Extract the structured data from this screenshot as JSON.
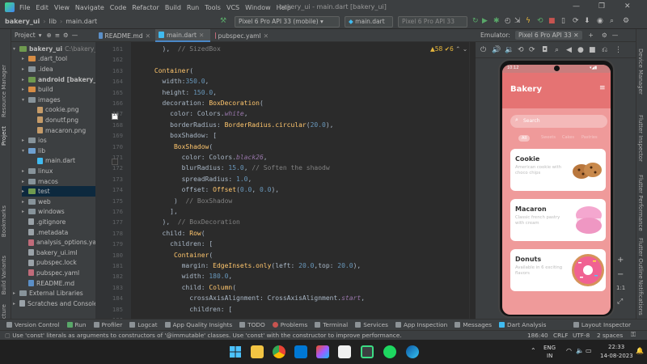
{
  "menu": {
    "items": [
      "File",
      "Edit",
      "View",
      "Navigate",
      "Code",
      "Refactor",
      "Build",
      "Run",
      "Tools",
      "VCS",
      "Window",
      "Help"
    ],
    "window_title": "bakery_ui - main.dart [bakery_ui]"
  },
  "nav": {
    "crumbs": [
      "bakery_ui",
      "lib",
      "main.dart"
    ],
    "device_combo": "Pixel 6 Pro API 33 (mobile)",
    "run_config": "main.dart",
    "avd_combo": "Pixel 6 Pro API 33"
  },
  "left_stripe": {
    "tabs": [
      "Resource Manager",
      "Project",
      "Bookmarks",
      "Build Variants",
      "Structure"
    ]
  },
  "project": {
    "header": "Project",
    "rows": [
      {
        "label": "bakery_ui",
        "suffix": "C:\\bakery_u",
        "type": "folder",
        "color": "gr",
        "indent": 0,
        "arrow": "▾",
        "bold": true
      },
      {
        "label": ".dart_tool",
        "type": "folder",
        "color": "or",
        "indent": 1,
        "arrow": "▸"
      },
      {
        "label": ".idea",
        "type": "folder",
        "color": "",
        "indent": 1,
        "arrow": "▸"
      },
      {
        "label": "android [bakery_ui",
        "type": "folder",
        "color": "gr",
        "indent": 1,
        "arrow": "▸",
        "bold": true
      },
      {
        "label": "build",
        "type": "folder",
        "color": "or",
        "indent": 1,
        "arrow": "▸"
      },
      {
        "label": "images",
        "type": "folder",
        "color": "",
        "indent": 1,
        "arrow": "▾"
      },
      {
        "label": "cookie.png",
        "type": "img",
        "indent": 2,
        "arrow": ""
      },
      {
        "label": "donutf.png",
        "type": "img",
        "indent": 2,
        "arrow": ""
      },
      {
        "label": "macaron.png",
        "type": "img",
        "indent": 2,
        "arrow": ""
      },
      {
        "label": "ios",
        "type": "folder",
        "color": "",
        "indent": 1,
        "arrow": "▸"
      },
      {
        "label": "lib",
        "type": "folder",
        "color": "bl",
        "indent": 1,
        "arrow": "▾"
      },
      {
        "label": "main.dart",
        "type": "dart",
        "indent": 2,
        "arrow": ""
      },
      {
        "label": "linux",
        "type": "folder",
        "color": "",
        "indent": 1,
        "arrow": "▸"
      },
      {
        "label": "macos",
        "type": "folder",
        "color": "",
        "indent": 1,
        "arrow": "▸"
      },
      {
        "label": "test",
        "type": "folder",
        "color": "gr",
        "indent": 1,
        "arrow": "▸",
        "sel": true
      },
      {
        "label": "web",
        "type": "folder",
        "color": "",
        "indent": 1,
        "arrow": "▸"
      },
      {
        "label": "windows",
        "type": "folder",
        "color": "",
        "indent": 1,
        "arrow": "▸"
      },
      {
        "label": ".gitignore",
        "type": "file",
        "indent": 1,
        "arrow": ""
      },
      {
        "label": ".metadata",
        "type": "file",
        "indent": 1,
        "arrow": ""
      },
      {
        "label": "analysis_options.yam",
        "type": "yaml",
        "indent": 1,
        "arrow": ""
      },
      {
        "label": "bakery_ui.iml",
        "type": "file",
        "indent": 1,
        "arrow": ""
      },
      {
        "label": "pubspec.lock",
        "type": "file",
        "indent": 1,
        "arrow": ""
      },
      {
        "label": "pubspec.yaml",
        "type": "yaml",
        "indent": 1,
        "arrow": ""
      },
      {
        "label": "README.md",
        "type": "md",
        "indent": 1,
        "arrow": ""
      },
      {
        "label": "External Libraries",
        "type": "folder",
        "color": "",
        "indent": 0,
        "arrow": "▸"
      },
      {
        "label": "Scratches and Console",
        "type": "file",
        "indent": 0,
        "arrow": "▸"
      }
    ]
  },
  "editor": {
    "tabs": [
      {
        "label": "README.md",
        "active": false
      },
      {
        "label": "main.dart",
        "active": true
      },
      {
        "label": "pubspec.yaml",
        "active": false
      }
    ],
    "inspections": "▲58  ✔6",
    "lines": [
      {
        "n": "161",
        "tokens": [
          {
            "t": "        ),  ",
            "c": ""
          },
          {
            "t": "// SizedBox",
            "c": "c"
          }
        ]
      },
      {
        "n": "162",
        "tokens": [
          {
            "t": "",
            "c": ""
          }
        ]
      },
      {
        "n": "163",
        "tokens": [
          {
            "t": "      ",
            "c": ""
          },
          {
            "t": "Container",
            "c": "cls"
          },
          {
            "t": "(",
            "c": ""
          }
        ]
      },
      {
        "n": "164",
        "tokens": [
          {
            "t": "        width:",
            "c": ""
          },
          {
            "t": "350.0",
            "c": "n"
          },
          {
            "t": ",",
            "c": ""
          }
        ]
      },
      {
        "n": "165",
        "tokens": [
          {
            "t": "        height: ",
            "c": ""
          },
          {
            "t": "150.0",
            "c": "n"
          },
          {
            "t": ",",
            "c": ""
          }
        ]
      },
      {
        "n": "166",
        "tokens": [
          {
            "t": "        decoration: ",
            "c": ""
          },
          {
            "t": "BoxDecoration",
            "c": "cls"
          },
          {
            "t": "(",
            "c": ""
          }
        ]
      },
      {
        "n": "167",
        "tokens": [
          {
            "t": "          color: Colors.",
            "c": ""
          },
          {
            "t": "white",
            "c": "p"
          },
          {
            "t": ",",
            "c": ""
          }
        ]
      },
      {
        "n": "168",
        "tokens": [
          {
            "t": "          borderRadius: ",
            "c": ""
          },
          {
            "t": "BorderRadius.circular",
            "c": "f"
          },
          {
            "t": "(",
            "c": ""
          },
          {
            "t": "20.0",
            "c": "n"
          },
          {
            "t": "),",
            "c": ""
          }
        ]
      },
      {
        "n": "169",
        "tokens": [
          {
            "t": "          boxShadow: [",
            "c": ""
          }
        ]
      },
      {
        "n": "170",
        "tokens": [
          {
            "t": "           ",
            "c": ""
          },
          {
            "t": "BoxShadow",
            "c": "cls"
          },
          {
            "t": "(",
            "c": ""
          }
        ]
      },
      {
        "n": "171",
        "tokens": [
          {
            "t": "             color: Colors.",
            "c": ""
          },
          {
            "t": "black26",
            "c": "p"
          },
          {
            "t": ",",
            "c": ""
          }
        ]
      },
      {
        "n": "172",
        "tokens": [
          {
            "t": "             blurRadius: ",
            "c": ""
          },
          {
            "t": "15.0",
            "c": "n"
          },
          {
            "t": ", ",
            "c": ""
          },
          {
            "t": "// Soften the shaodw",
            "c": "c"
          }
        ]
      },
      {
        "n": "173",
        "tokens": [
          {
            "t": "             spreadRadius: ",
            "c": ""
          },
          {
            "t": "1.0",
            "c": "n"
          },
          {
            "t": ",",
            "c": ""
          }
        ]
      },
      {
        "n": "174",
        "tokens": [
          {
            "t": "             offset: ",
            "c": ""
          },
          {
            "t": "Offset",
            "c": "cls"
          },
          {
            "t": "(",
            "c": ""
          },
          {
            "t": "0.0",
            "c": "n"
          },
          {
            "t": ", ",
            "c": ""
          },
          {
            "t": "0.0",
            "c": "n"
          },
          {
            "t": "),",
            "c": ""
          }
        ]
      },
      {
        "n": "175",
        "tokens": [
          {
            "t": "           )  ",
            "c": ""
          },
          {
            "t": "// BoxShadow",
            "c": "c"
          }
        ]
      },
      {
        "n": "176",
        "tokens": [
          {
            "t": "          ],",
            "c": ""
          }
        ]
      },
      {
        "n": "177",
        "tokens": [
          {
            "t": "        ),  ",
            "c": ""
          },
          {
            "t": "// BoxDecoration",
            "c": "c"
          }
        ]
      },
      {
        "n": "178",
        "tokens": [
          {
            "t": "        child: ",
            "c": ""
          },
          {
            "t": "Row",
            "c": "cls"
          },
          {
            "t": "(",
            "c": ""
          }
        ]
      },
      {
        "n": "179",
        "tokens": [
          {
            "t": "          children: [",
            "c": ""
          }
        ]
      },
      {
        "n": "180",
        "tokens": [
          {
            "t": "           ",
            "c": ""
          },
          {
            "t": "Container",
            "c": "cls"
          },
          {
            "t": "(",
            "c": ""
          }
        ]
      },
      {
        "n": "181",
        "tokens": [
          {
            "t": "             margin: ",
            "c": ""
          },
          {
            "t": "EdgeInsets.only",
            "c": "f"
          },
          {
            "t": "(left: ",
            "c": ""
          },
          {
            "t": "20.0",
            "c": "n"
          },
          {
            "t": ",top: ",
            "c": ""
          },
          {
            "t": "20.0",
            "c": "n"
          },
          {
            "t": "),",
            "c": ""
          }
        ]
      },
      {
        "n": "182",
        "tokens": [
          {
            "t": "             width: ",
            "c": ""
          },
          {
            "t": "180.0",
            "c": "n"
          },
          {
            "t": ",",
            "c": ""
          }
        ]
      },
      {
        "n": "183",
        "tokens": [
          {
            "t": "             child: ",
            "c": ""
          },
          {
            "t": "Column",
            "c": "cls"
          },
          {
            "t": "(",
            "c": ""
          }
        ]
      },
      {
        "n": "184",
        "tokens": [
          {
            "t": "               crossAxisAlignment: CrossAxisAlignment.",
            "c": ""
          },
          {
            "t": "start",
            "c": "p"
          },
          {
            "t": ",",
            "c": ""
          }
        ]
      },
      {
        "n": "185",
        "tokens": [
          {
            "t": "               children: [",
            "c": ""
          }
        ]
      },
      {
        "n": "186",
        "tokens": [
          {
            "t": "",
            "c": ""
          }
        ]
      }
    ]
  },
  "emulator": {
    "label": "Emulator:",
    "device": "Pixel 6 Pro API 33"
  },
  "app": {
    "title": "Bakery",
    "search": "Search",
    "categories": [
      "All",
      "Sweets",
      "Cakes",
      "Pastries"
    ],
    "cards": [
      {
        "title": "Cookie",
        "subtitle": "American cookie with choco chips"
      },
      {
        "title": "Macaron",
        "subtitle": "Classic french pastry with cream"
      },
      {
        "title": "Donuts",
        "subtitle": "Available in 6 exciting flavors"
      }
    ],
    "status_time": "10:12"
  },
  "right_stripe": {
    "tabs": [
      "Device Manager",
      "Flutter Inspector",
      "Flutter Performance",
      "Flutter Outline",
      "Notifications"
    ]
  },
  "bottom_tools": [
    "Version Control",
    "Run",
    "Profiler",
    "Logcat",
    "App Quality Insights",
    "TODO",
    "Problems",
    "Terminal",
    "Services",
    "App Inspection",
    "Messages",
    "Dart Analysis"
  ],
  "layout_inspector": "Layout Inspector",
  "status": {
    "message": "Use 'const' literals as arguments to constructors of '@immutable' classes. Use 'const' with the constructor to improve performance.",
    "pos": "186:40",
    "eol": "CRLF",
    "enc": "UTF-8",
    "indent": "2 spaces"
  },
  "taskbar": {
    "lang": "ENG",
    "region": "IN",
    "time": "22:33",
    "date": "14-08-2023"
  },
  "colors": {
    "accent": "#4a88c7",
    "app_bg": "#ef9a9a",
    "app_bar": "#e57373"
  }
}
